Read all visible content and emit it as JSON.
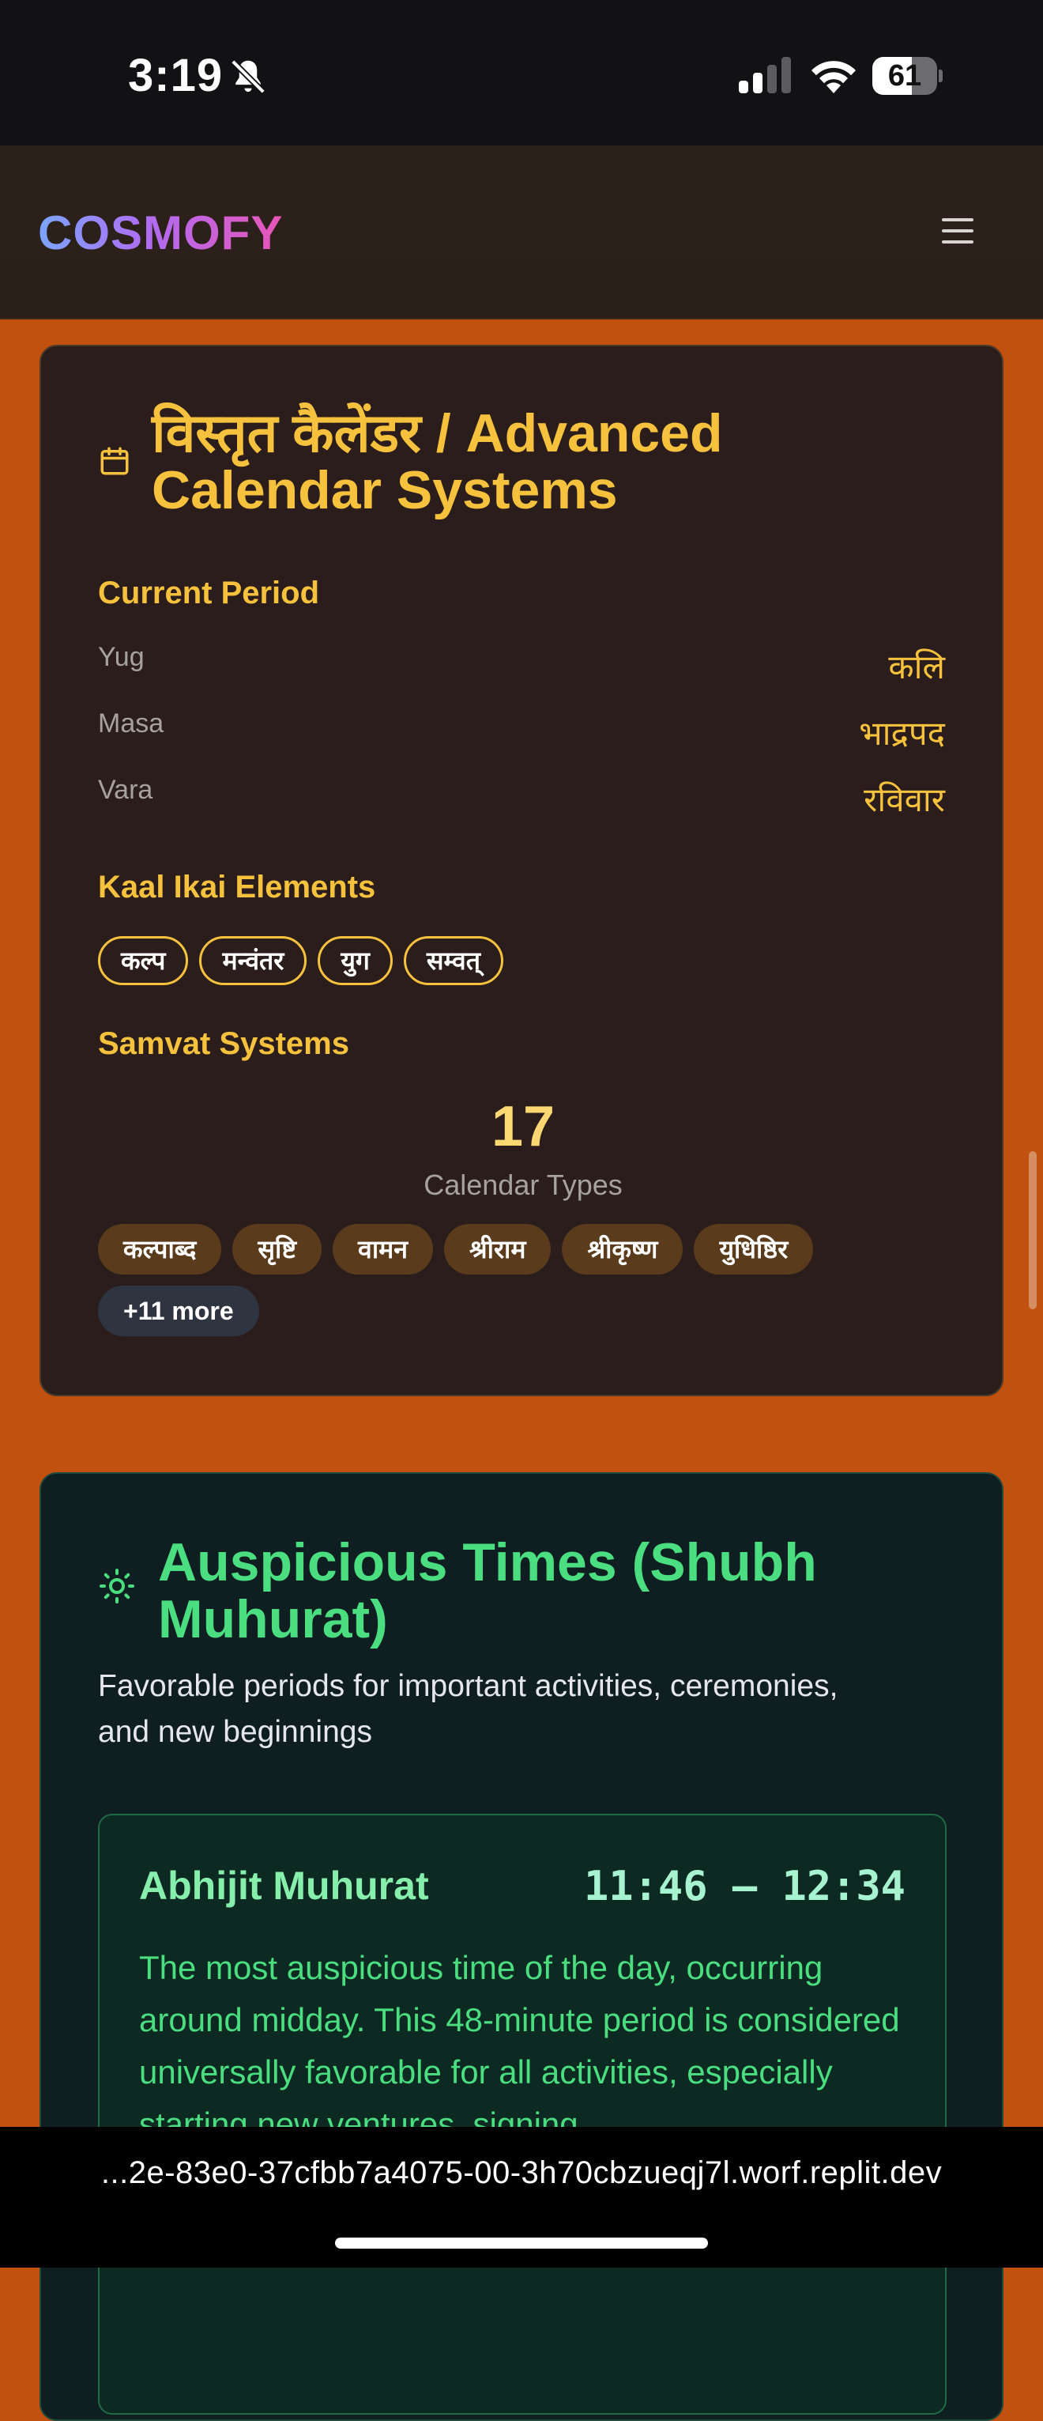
{
  "status_bar": {
    "time": "3:19",
    "battery": "61",
    "battery_fraction": 0.61
  },
  "header": {
    "logo": "COSMOFY",
    "menu_icon": "hamburger-menu-icon"
  },
  "calendar_card": {
    "icon": "calendar-icon",
    "title": "विस्तृत कैलेंडर / Advanced Calendar Systems",
    "current_period": {
      "heading": "Current Period",
      "rows": [
        {
          "key": "Yug",
          "value": "कलि"
        },
        {
          "key": "Masa",
          "value": "भाद्रपद"
        },
        {
          "key": "Vara",
          "value": "रविवार"
        }
      ]
    },
    "kaal_ikai": {
      "heading": "Kaal Ikai Elements",
      "items": [
        "कल्प",
        "मन्वंतर",
        "युग",
        "सम्वत्"
      ]
    },
    "samvat": {
      "heading": "Samvat Systems",
      "count": "17",
      "count_label": "Calendar Types",
      "items": [
        "कल्पाब्द",
        "सृष्टि",
        "वामन",
        "श्रीराम",
        "श्रीकृष्ण",
        "युधिष्ठिर"
      ],
      "more": "+11 more"
    }
  },
  "muhurat_card": {
    "icon": "sun-icon",
    "title": "Auspicious Times (Shubh Muhurat)",
    "subtitle": "Favorable periods for important activities, ceremonies, and new beginnings",
    "item": {
      "name": "Abhijit Muhurat",
      "time": "11:46 – 12:34",
      "description": "The most auspicious time of the day, occurring around midday. This 48-minute period is considered universally favorable for all activities, especially starting new ventures, signing"
    }
  },
  "browser": {
    "url": "...2e-83e0-37cfbb7a4075-00-3h70cbzueqj7l.worf.replit.dev"
  }
}
